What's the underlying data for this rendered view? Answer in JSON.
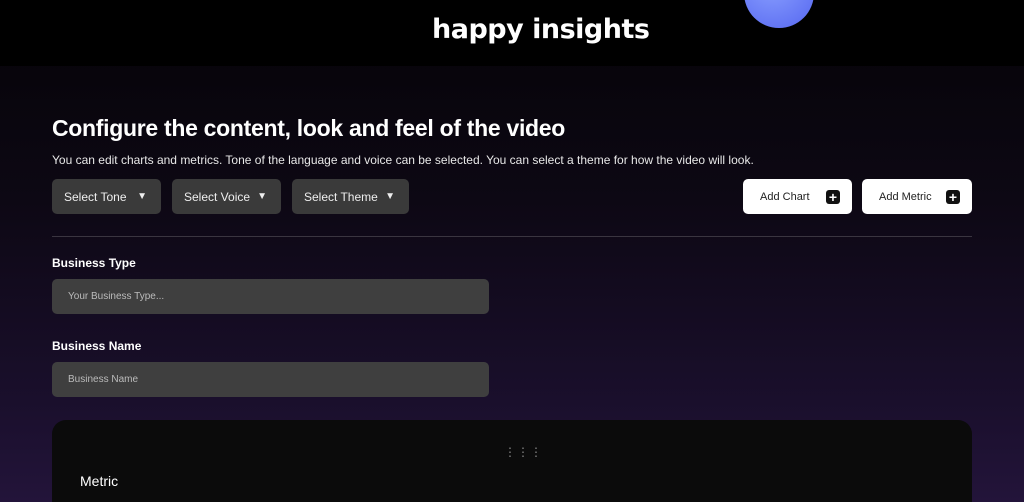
{
  "header": {
    "logo": "happy insights"
  },
  "main": {
    "title": "Configure the content, look and feel of the video",
    "subtitle": "You can edit charts and metrics. Tone of the language and voice can be selected. You can select a theme for how the video will look.",
    "selects": {
      "tone": "Select Tone",
      "voice": "Select Voice",
      "theme": "Select Theme",
      "arrow": "▼"
    },
    "buttons": {
      "add_chart": "Add Chart",
      "add_metric": "Add Metric",
      "plus": "+"
    },
    "business_type": {
      "label": "Business Type",
      "placeholder": "Your Business Type..."
    },
    "business_name": {
      "label": "Business Name",
      "placeholder": "Business Name"
    },
    "card": {
      "handle": "⋮⋮⋮",
      "title": "Metric"
    }
  }
}
